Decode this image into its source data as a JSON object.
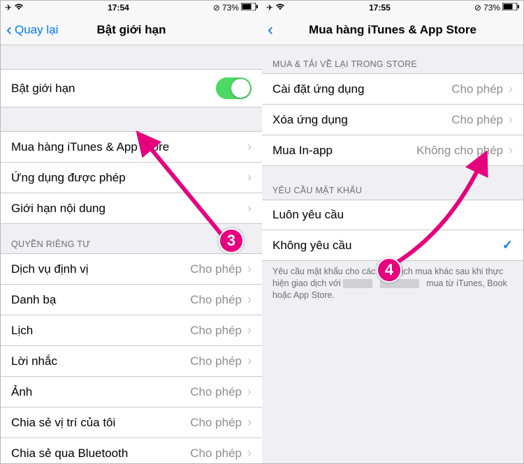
{
  "left": {
    "status": {
      "time": "17:54",
      "battery": "73%"
    },
    "nav": {
      "back": "Quay lại",
      "title": "Bật giới hạn"
    },
    "toggle": {
      "label": "Bật giới hạn"
    },
    "rows1": [
      {
        "label": "Mua hàng iTunes & App Store"
      },
      {
        "label": "Ứng dụng được phép"
      },
      {
        "label": "Giới hạn nội dung"
      }
    ],
    "header_privacy": "QUYỀN RIÊNG TƯ",
    "rows_privacy": [
      {
        "label": "Dịch vụ định vị",
        "value": "Cho phép"
      },
      {
        "label": "Danh bạ",
        "value": "Cho phép"
      },
      {
        "label": "Lịch",
        "value": "Cho phép"
      },
      {
        "label": "Lời nhắc",
        "value": "Cho phép"
      },
      {
        "label": "Ảnh",
        "value": "Cho phép"
      },
      {
        "label": "Chia sẻ vị trí của tôi",
        "value": "Cho phép"
      },
      {
        "label": "Chia sẻ qua Bluetooth",
        "value": "Cho phép"
      }
    ]
  },
  "right": {
    "status": {
      "time": "17:55",
      "battery": "73%"
    },
    "nav": {
      "title": "Mua hàng iTunes & App Store"
    },
    "header_store": "MUA & TẢI VỀ LẠI TRONG STORE",
    "rows_store": [
      {
        "label": "Cài đặt ứng dụng",
        "value": "Cho phép"
      },
      {
        "label": "Xóa ứng dụng",
        "value": "Cho phép"
      },
      {
        "label": "Mua In-app",
        "value": "Không cho phép"
      }
    ],
    "header_pw": "YÊU CẦU MẬT KHẨU",
    "rows_pw": [
      {
        "label": "Luôn yêu cầu"
      },
      {
        "label": "Không yêu cầu"
      }
    ],
    "footer_pre": "Yêu cầu mật khẩu cho các giao dịch mua khác sau khi thực hiện giao dịch với ",
    "footer_post": " mua từ iTunes, Book hoặc App Store."
  },
  "annotations": {
    "badge3": "3",
    "badge4": "4"
  }
}
